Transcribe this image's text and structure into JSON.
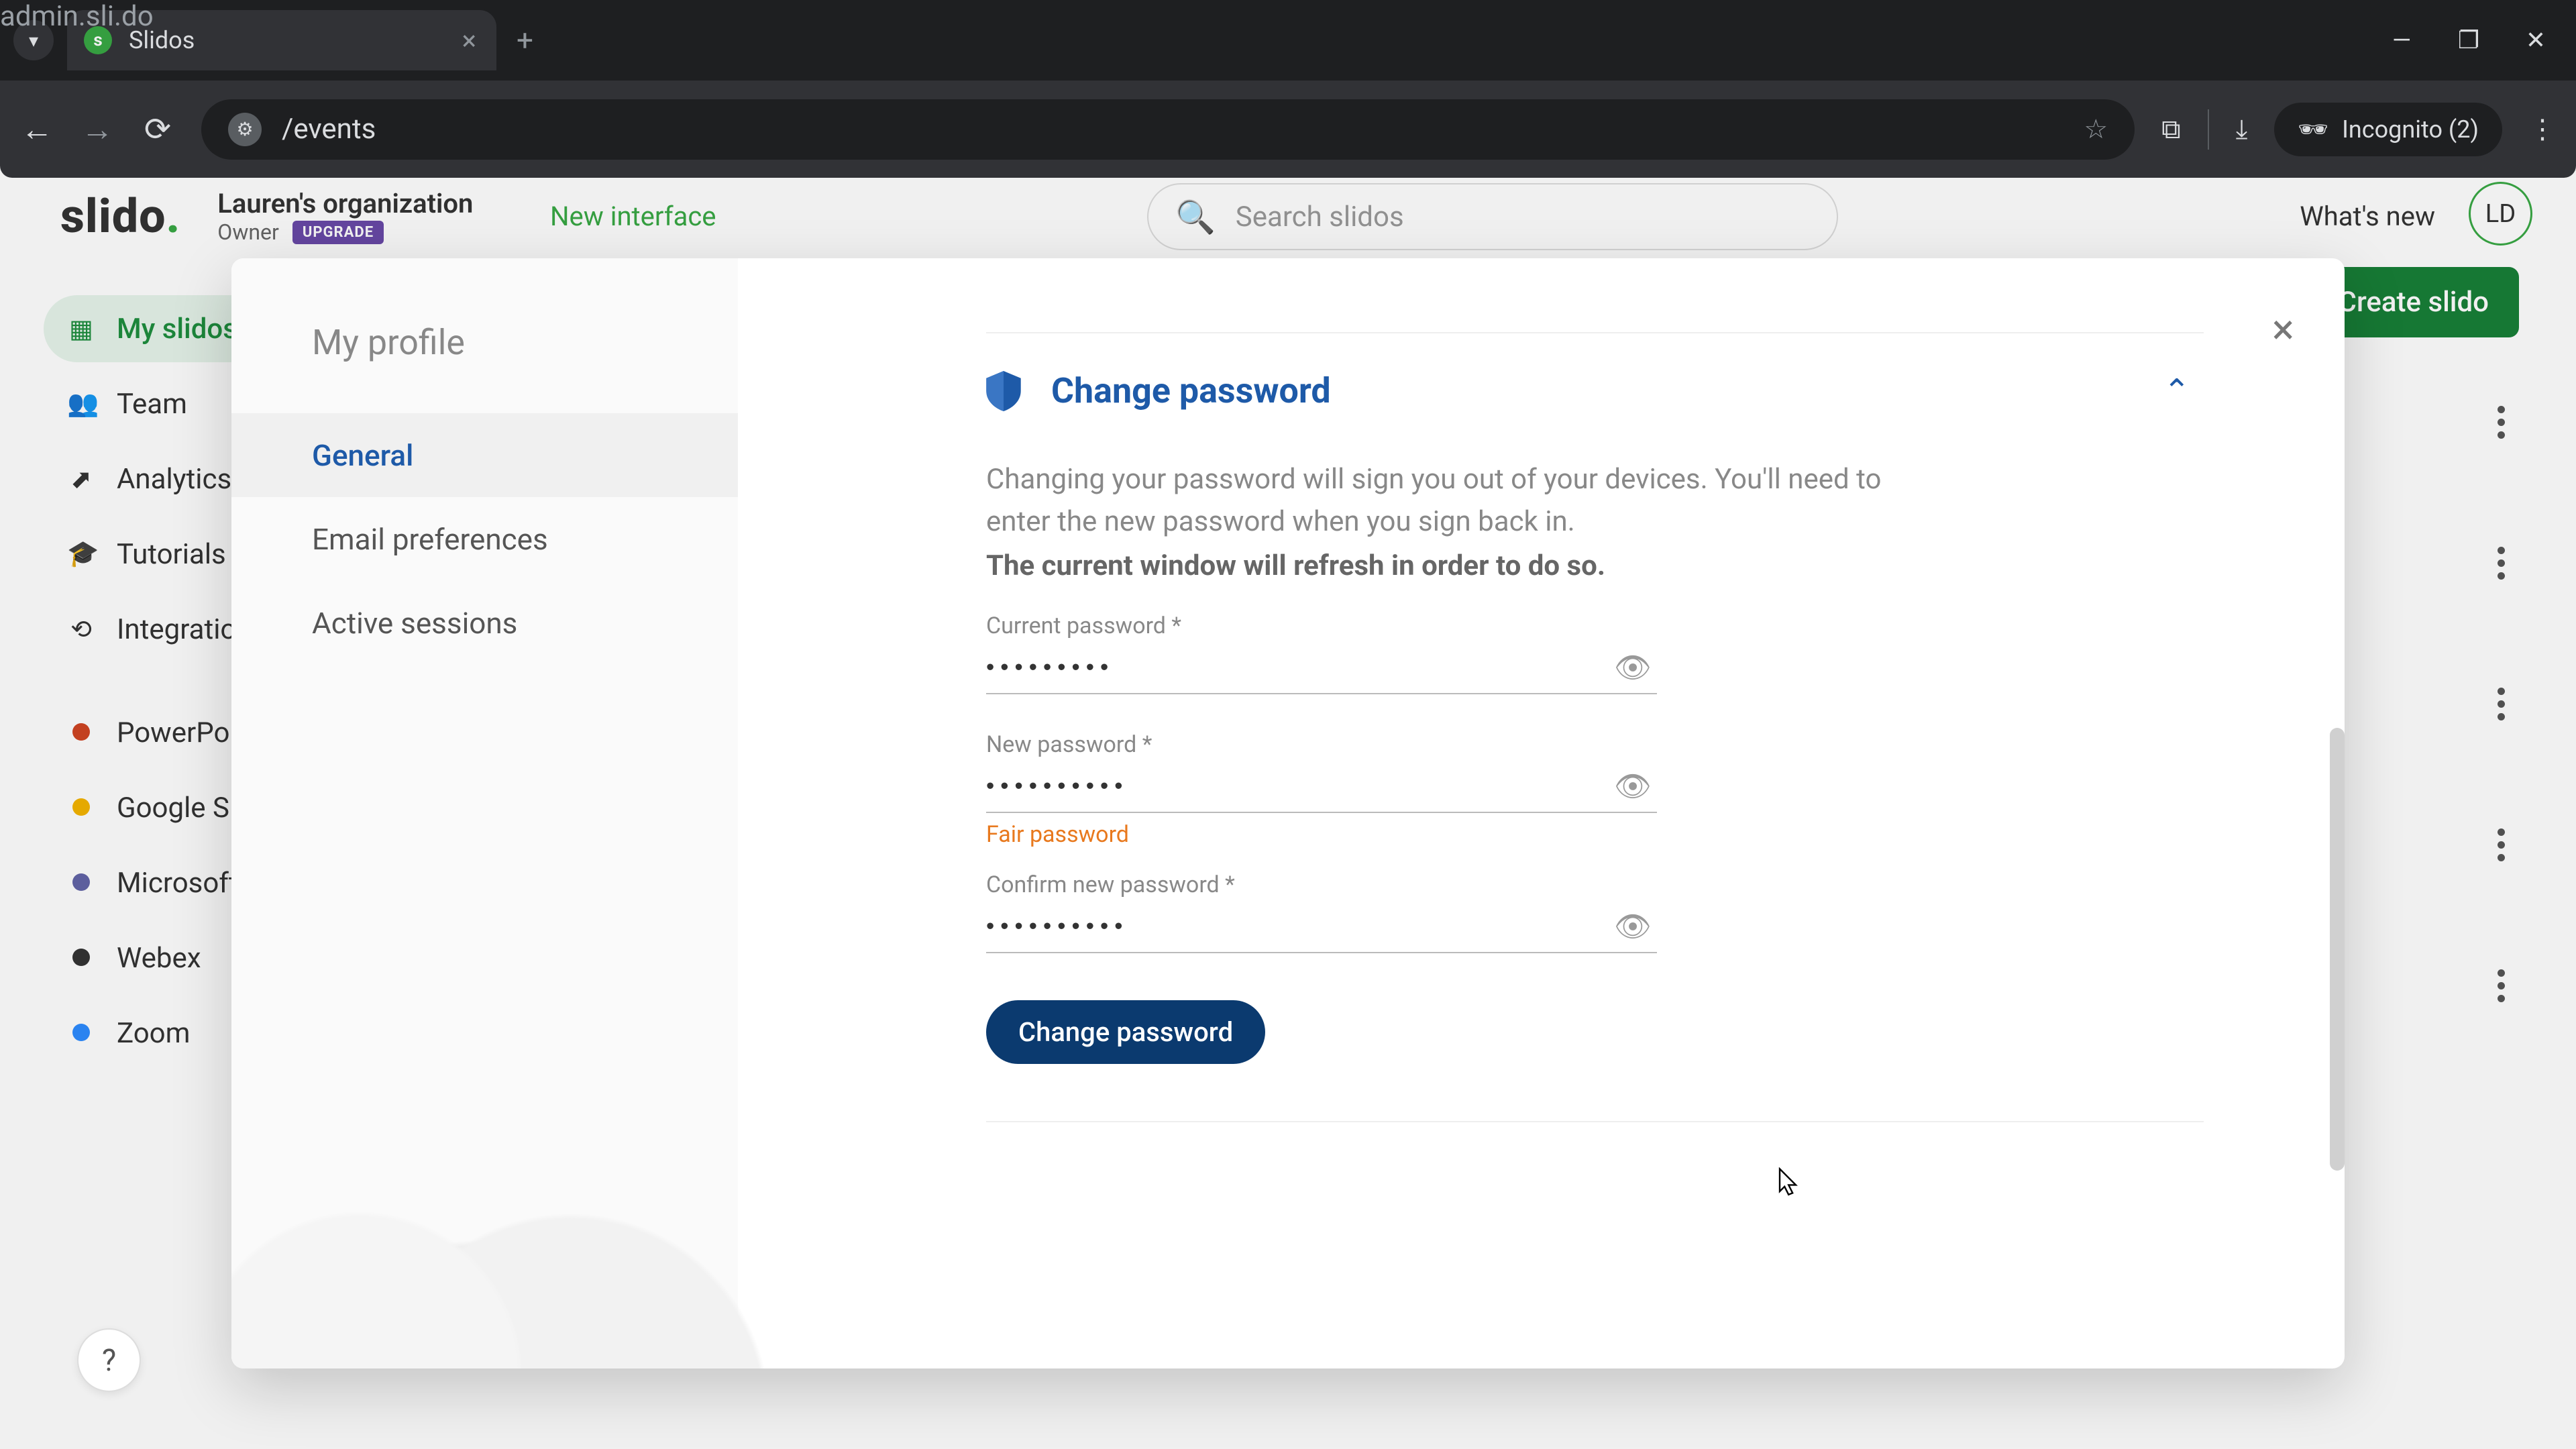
{
  "browser": {
    "tab_title": "Slidos",
    "url_host": "admin.sli.do",
    "url_path": "/events",
    "incognito_label": "Incognito (2)"
  },
  "app": {
    "logo_text": "slido",
    "org_name": "Lauren's organization",
    "org_role": "Owner",
    "upgrade_badge": "UPGRADE",
    "new_interface": "New interface",
    "search_placeholder": "Search slidos",
    "whats_new": "What's new",
    "avatar_initials": "LD",
    "create_button": "+ Create slido"
  },
  "sidebar": {
    "items": [
      {
        "label": "My slidos",
        "icon": "▦"
      },
      {
        "label": "Team",
        "icon": "👥"
      },
      {
        "label": "Analytics",
        "icon": "⬈"
      },
      {
        "label": "Tutorials",
        "icon": "🎓"
      },
      {
        "label": "Integrations",
        "icon": "⟲"
      }
    ],
    "integrations": [
      {
        "label": "PowerPoint",
        "color": "#d04423"
      },
      {
        "label": "Google Slides",
        "color": "#f4b400"
      },
      {
        "label": "Microsoft Teams",
        "color": "#6264a7"
      },
      {
        "label": "Webex",
        "color": "#333333"
      },
      {
        "label": "Zoom",
        "color": "#2d8cff"
      }
    ]
  },
  "modal": {
    "title": "My profile",
    "nav": [
      {
        "label": "General",
        "active": true
      },
      {
        "label": "Email preferences",
        "active": false
      },
      {
        "label": "Active sessions",
        "active": false
      }
    ],
    "section": {
      "heading": "Change password",
      "desc1": "Changing your password will sign you out of your devices. You'll need to enter the new password when you sign back in.",
      "desc2": "The current window will refresh in order to do so.",
      "fields": {
        "current": {
          "label": "Current password *",
          "masked": "•••••••••"
        },
        "new": {
          "label": "New password *",
          "masked": "••••••••••",
          "strength": "Fair password"
        },
        "confirm": {
          "label": "Confirm new password *",
          "masked": "••••••••••"
        }
      },
      "submit_label": "Change password"
    }
  },
  "help_label": "?"
}
